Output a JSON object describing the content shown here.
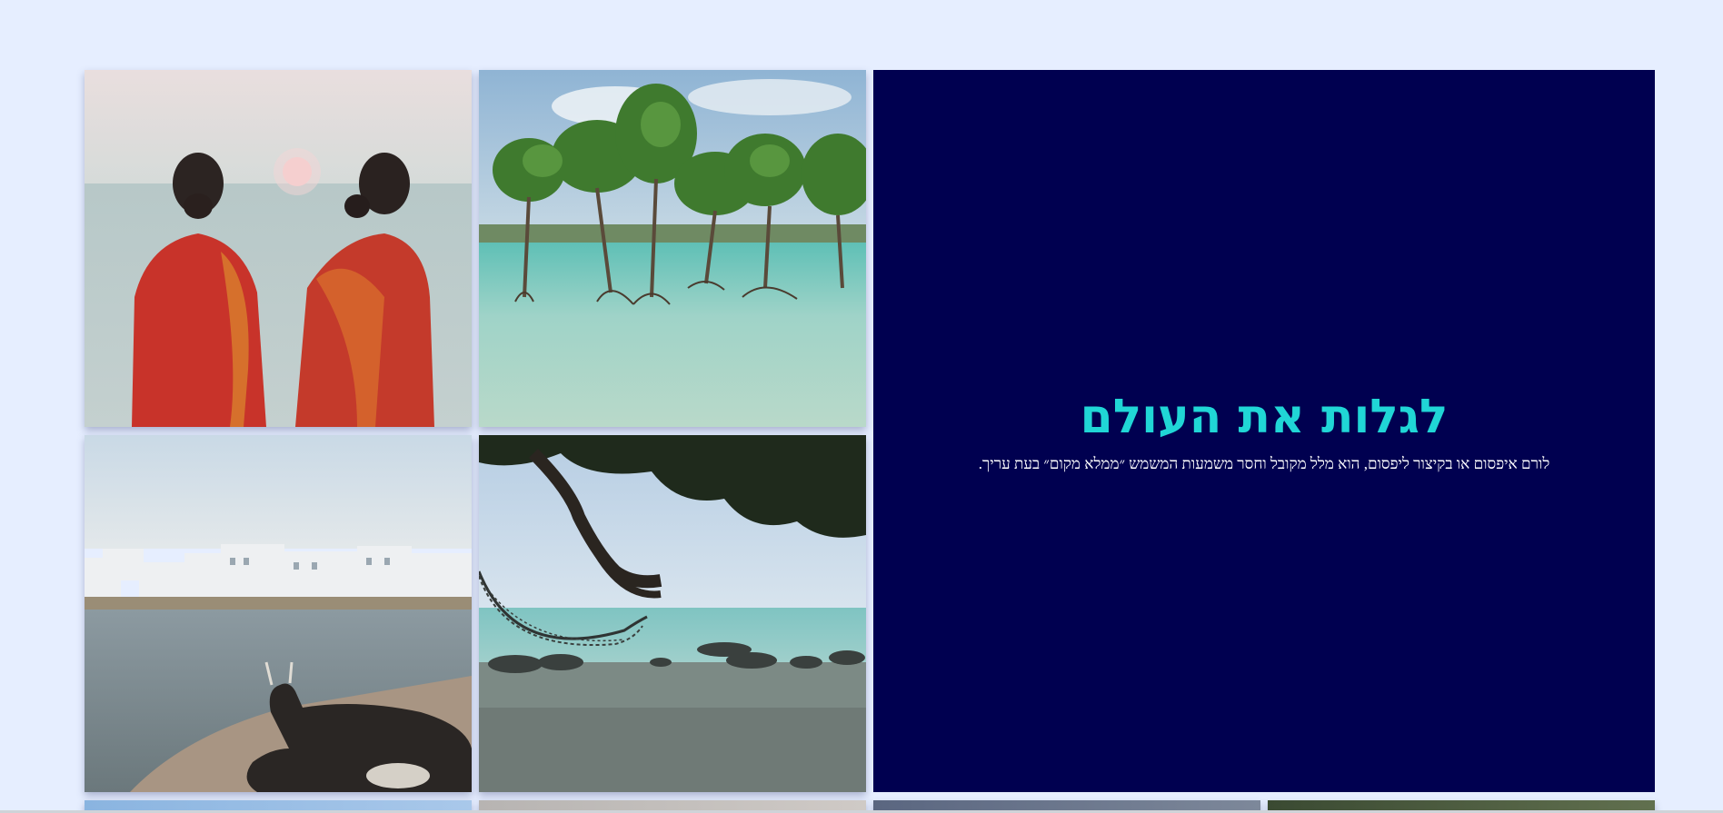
{
  "feature": {
    "title": "לגלות את העולם",
    "text": "לורם איפסום או בקיצור ליפסום, הוא מלל מקובל וחסר משמעות המשמש ״ממלא מקום״ בעת עריך."
  },
  "photos": [
    {
      "name": "photo-women-saris-sunset",
      "subject": "two women in red saris watching the sunset over the sea"
    },
    {
      "name": "photo-mangroves",
      "subject": "mangrove trees standing in turquoise water"
    },
    {
      "name": "photo-cow-lake",
      "subject": "cow resting on a ghat beside a lake with white town behind"
    },
    {
      "name": "photo-hammock-beach",
      "subject": "hammock under a tree on a rocky beach"
    },
    {
      "name": "photo-bottom-1",
      "subject": "partially visible photo"
    },
    {
      "name": "photo-bottom-2",
      "subject": "partially visible photo"
    },
    {
      "name": "photo-bottom-3",
      "subject": "partially visible photo"
    },
    {
      "name": "photo-bottom-4",
      "subject": "partially visible photo"
    }
  ],
  "colors": {
    "page_background": "#e6eeff",
    "feature_background": "#000050",
    "title": "#20d6d6",
    "text": "#ffffff"
  }
}
